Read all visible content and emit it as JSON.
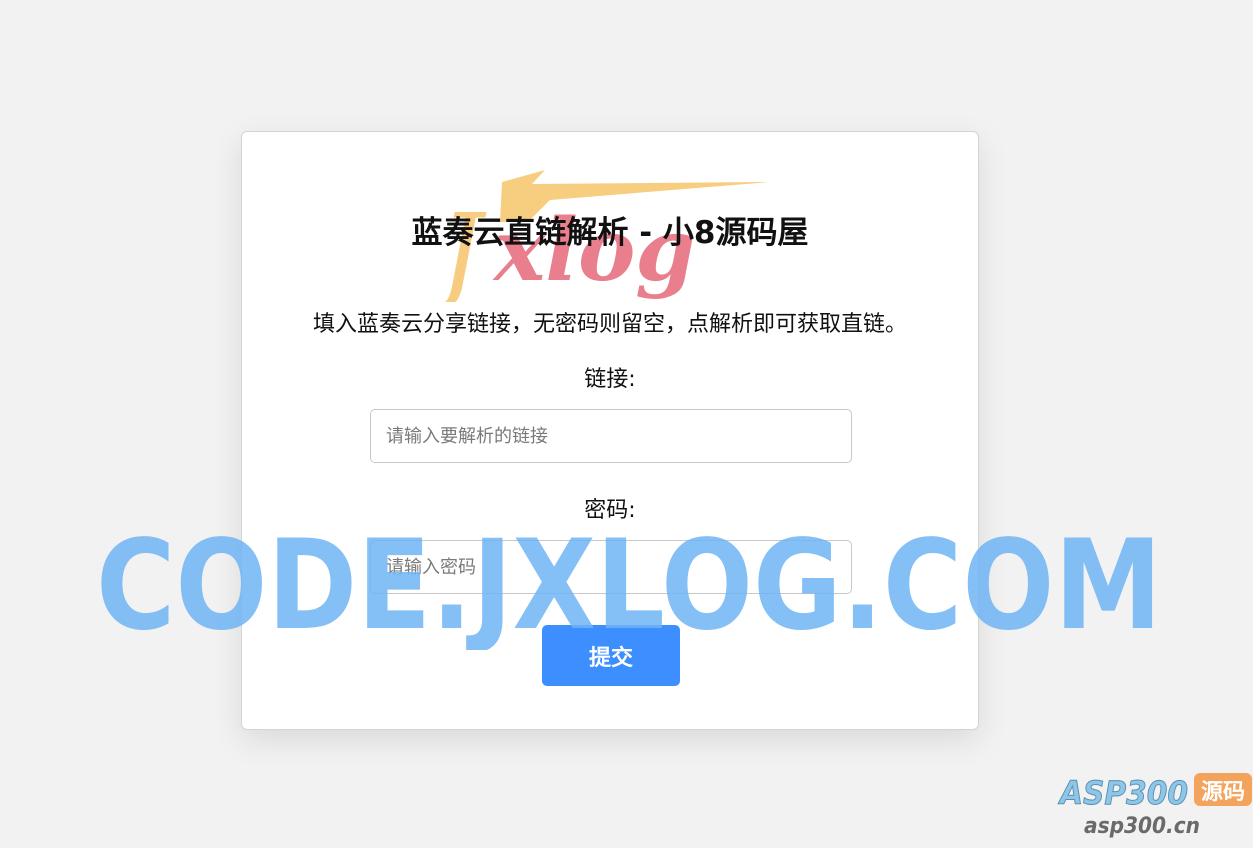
{
  "page": {
    "title": "蓝奏云直链解析 - 小8源码屋",
    "instruction": "填入蓝奏云分享链接，无密码则留空，点解析即可获取直链。"
  },
  "form": {
    "link_label": "链接:",
    "link_placeholder": "请输入要解析的链接",
    "link_value": "",
    "password_label": "密码:",
    "password_placeholder": "请输入密码",
    "password_value": "",
    "submit_label": "提交"
  },
  "overlays": {
    "logo_text": "Jxlog",
    "watermark_text": "CODE.JXLOG.COM",
    "corner_brand": "ASP300",
    "corner_badge": "源码",
    "corner_url": "asp300.cn"
  },
  "colors": {
    "background": "#f2f2f2",
    "card": "#ffffff",
    "accent": "#3d8eff",
    "watermark": "#6fb4f5",
    "logo_gold": "#f6c46a",
    "logo_red": "#e45c6c"
  }
}
